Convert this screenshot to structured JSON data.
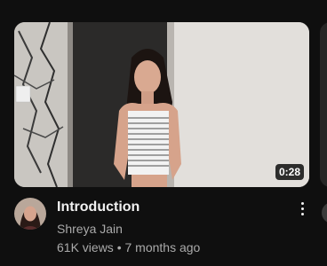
{
  "video": {
    "duration": "0:28",
    "title": "Introduction",
    "channel": "Shreya Jain",
    "views": "61K views",
    "separator": "•",
    "age": "7 months ago"
  },
  "icons": {
    "menu": "more-vert-icon"
  },
  "colors": {
    "background": "#0f0f0f",
    "title": "#f1f1f1",
    "secondary_text": "#aaaaaa"
  }
}
